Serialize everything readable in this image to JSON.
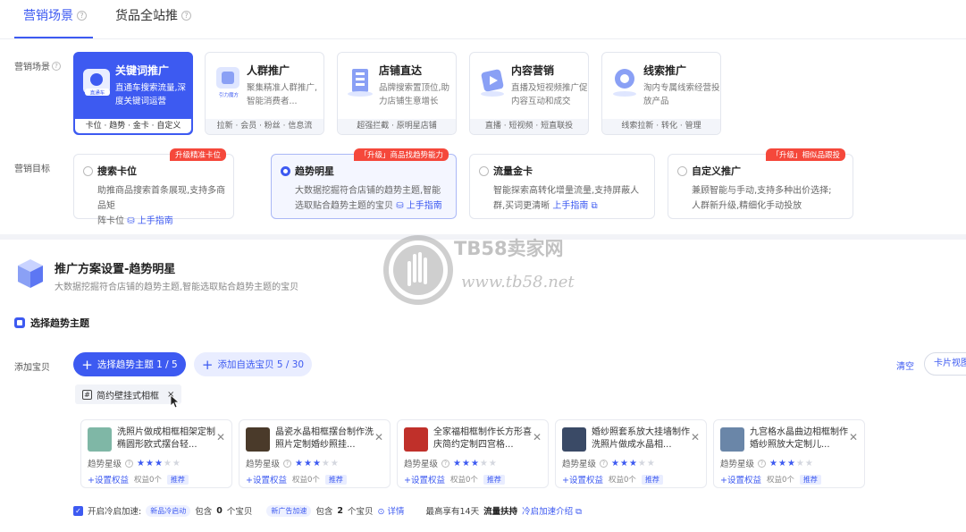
{
  "tabs": [
    {
      "label": "营销场景"
    },
    {
      "label": "货品全站推"
    }
  ],
  "scene_section": {
    "label": "营销场景",
    "cards": [
      {
        "title": "关键词推广",
        "desc": "直通车搜索流量,深度关键词运营",
        "foot": "卡位 · 趋势 · 金卡 · 自定义",
        "icon_label": "直通车"
      },
      {
        "title": "人群推广",
        "desc": "聚集精准人群推广,智能消费者...",
        "foot": "拉新 · 会员 · 粉丝 · 信息流",
        "icon_label": "引力魔方"
      },
      {
        "title": "店铺直达",
        "desc": "品牌搜索置顶位,助力店铺生意增长",
        "foot": "超强拦截 · 原明星店铺"
      },
      {
        "title": "内容营销",
        "desc": "直播及短视频推广促内容互动和成交",
        "foot": "直播 · 短视频 · 短直联投"
      },
      {
        "title": "线索推广",
        "desc": "淘内专属线索经营投放产品",
        "foot": "线索拉新 · 转化 · 管理"
      }
    ]
  },
  "goal_section": {
    "label": "营销目标",
    "cards": [
      {
        "title": "搜索卡位",
        "desc1": "助推商品搜索首条展现,支持多商品矩",
        "desc2": "阵卡位",
        "guide": "上手指南",
        "badge": "升级精准卡位"
      },
      {
        "title": "趋势明星",
        "desc1": "大数据挖掘符合店铺的趋势主题,智能",
        "desc2": "选取贴合趋势主题的宝贝",
        "guide": "上手指南",
        "badge": "「升级」商品找趋势能力"
      },
      {
        "title": "流量金卡",
        "desc1": "智能探索高转化增量流量,支持屏蔽人",
        "desc2": "群,买词更清晰",
        "guide": "上手指南",
        "badge": ""
      },
      {
        "title": "自定义推广",
        "desc1": "兼顾智能与手动,支持多种出价选择;",
        "desc2": "人群新升级,精细化手动投放",
        "guide": "",
        "badge": "「升级」相似品跟投"
      }
    ]
  },
  "plan": {
    "title": "推广方案设置-趋势明星",
    "subtitle": "大数据挖掘符合店铺的趋势主题,智能选取贴合趋势主题的宝贝",
    "section_title": "选择趋势主题",
    "add_label": "添加宝贝",
    "btn_theme": "选择趋势主题 1 / 5",
    "btn_custom": "添加自选宝贝 5 / 30",
    "clear": "清空",
    "view": "卡片视图",
    "theme_tag": "简约壁挂式相框"
  },
  "products": [
    {
      "name": "洗照片做成相框相架定制椭圆形欧式摆台轻...",
      "star_label": "趋势星级",
      "stars": 3,
      "action": "+设置权益",
      "rights": "权益0个",
      "rec": "推荐",
      "thumb_color": "#7fb7a6"
    },
    {
      "name": "晶瓷水晶相框摆台制作洗照片定制婚纱照挂...",
      "star_label": "趋势星级",
      "stars": 3,
      "action": "+设置权益",
      "rights": "权益0个",
      "rec": "推荐",
      "thumb_color": "#4a3a2a"
    },
    {
      "name": "全家福相框制作长方形喜庆简约定制四宫格...",
      "star_label": "趋势星级",
      "stars": 3,
      "action": "+设置权益",
      "rights": "权益0个",
      "rec": "推荐",
      "thumb_color": "#c0302a"
    },
    {
      "name": "婚纱照套系放大挂墙制作洗照片做成水晶相...",
      "star_label": "趋势星级",
      "stars": 3,
      "action": "+设置权益",
      "rights": "权益0个",
      "rec": "推荐",
      "thumb_color": "#3a4a66"
    },
    {
      "name": "九宫格水晶曲边相框制作婚纱照放大定制儿...",
      "star_label": "趋势星级",
      "stars": 3,
      "action": "+设置权益",
      "rights": "权益0个",
      "rec": "推荐",
      "thumb_color": "#6a86a8"
    }
  ],
  "footer": {
    "cold_start": "开启冷启加速:",
    "pill1": "新品冷启动",
    "contains1_pre": "包含",
    "contains1_num": "0",
    "contains1_post": "个宝贝",
    "pill2": "新广告加速",
    "contains2_pre": "包含",
    "contains2_num": "2",
    "contains2_post": "个宝贝",
    "detail": "详情",
    "max_pre": "最高享有14天",
    "max_bold": "流量扶持",
    "intro": "冷启加速介绍"
  },
  "watermark": {
    "text1": "TB58卖家网",
    "text2": "www.tb58.net"
  },
  "colors": {
    "accent": "#3d5af1",
    "badge": "#f5483b"
  }
}
